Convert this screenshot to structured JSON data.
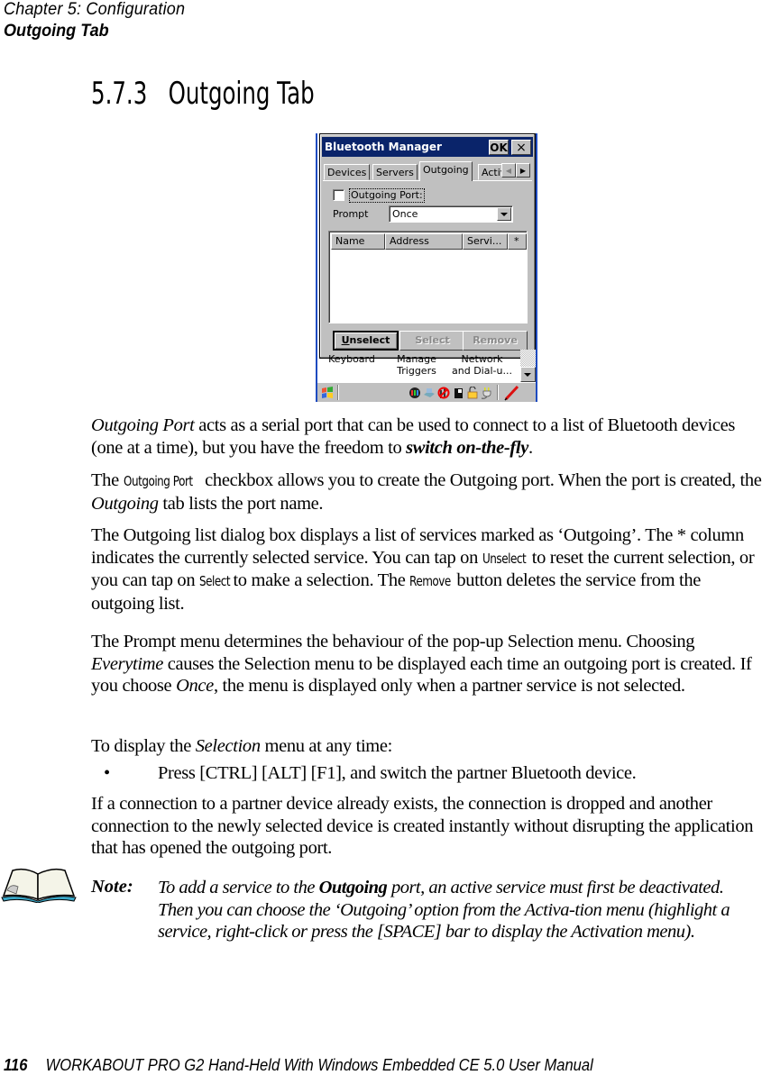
{
  "header": {
    "chapter": "Chapter  5:  Configuration",
    "section": "Outgoing Tab"
  },
  "section_title": "5.7.3   Outgoing Tab",
  "screenshot": {
    "title": "Bluetooth Manager",
    "ok_label": "OK",
    "close_label": "×",
    "tabs": [
      {
        "label": "Devices",
        "active": false
      },
      {
        "label": "Servers",
        "active": false
      },
      {
        "label": "Outgoing",
        "active": true
      },
      {
        "label": "Activ",
        "active": false
      }
    ],
    "tab_scroll_left": "◀",
    "tab_scroll_right": "▶",
    "outgoing_port_checkbox": {
      "label": "Outgoing Port:",
      "checked": false
    },
    "prompt": {
      "label": "Prompt",
      "value": "Once"
    },
    "list_columns": [
      "Name",
      "Address",
      "Servi...",
      "*"
    ],
    "list_rows": [],
    "buttons": [
      {
        "label": "Unselect",
        "enabled": true,
        "default": true
      },
      {
        "label": "Select",
        "enabled": false,
        "default": false
      },
      {
        "label": "Remove",
        "enabled": false,
        "default": false
      }
    ],
    "background_items": [
      "Keyboard",
      "Manage\nTriggers",
      "Network\nand Dial-u..."
    ],
    "tray_icons": [
      "color-wheel-icon",
      "network-icon",
      "no-signal-icon",
      "battery-icon",
      "lock-icon",
      "power-plug-icon",
      "pen-icon"
    ]
  },
  "paragraphs": {
    "p1": {
      "a_italic": "Outgoing Port",
      "b": " acts as a serial port that can be used to connect to a list of Bluetooth devices (one at a time), but you have the freedom to ",
      "c_bolditalic": "switch on-the-fly",
      "d": "."
    },
    "p2": {
      "a": "The ",
      "b_ui": "Outgoing Port",
      "c": " checkbox allows you to create the Outgoing port. When the port is created, the ",
      "d_italic": "Outgoing",
      "e": " tab lists the port name."
    },
    "p3": {
      "a": "The Outgoing list dialog box displays a list of services marked as ‘Outgoing’. The * column indicates the currently selected service. You can tap on ",
      "b_ui": "Unselect",
      "c": " to reset the current selection, or you can tap on ",
      "d_ui": "Select",
      "e": " to make a selection. The ",
      "f_ui": "Remove",
      "g": " button deletes the service from the outgoing list."
    },
    "p4": {
      "a": "The Prompt menu determines the behaviour of the pop-up Selection menu. Choosing ",
      "b_italic": "Everytime",
      "c": " causes the Selection menu to be displayed each time an outgoing port is created. If you choose ",
      "d_italic": "Once",
      "e": ", the menu is displayed only when a partner service is not selected."
    },
    "p5": {
      "a": "To display the ",
      "b_italic": "Selection",
      "c": " menu at any time:"
    },
    "bullet": {
      "mark": "•",
      "text": "Press [CTRL] [ALT] [F1], and switch the partner Bluetooth device."
    },
    "p6": "If a connection to a partner device already exists, the connection is dropped and another connection to the newly selected device is created instantly without disrupting the application that has opened the outgoing port."
  },
  "note": {
    "label": "Note:",
    "a": "To add a service to the ",
    "b_bold": "Outgoing",
    "c": " port, an active service must first be deactivated. Then you can choose the ‘Outgoing’ option from the Activa-tion menu (highlight a service, right-click or press the [SPACE] bar to display the Activation menu)."
  },
  "footer": {
    "page": "116",
    "title": "WORKABOUT PRO G2 Hand-Held With Windows Embedded CE 5.0 User Manual"
  }
}
